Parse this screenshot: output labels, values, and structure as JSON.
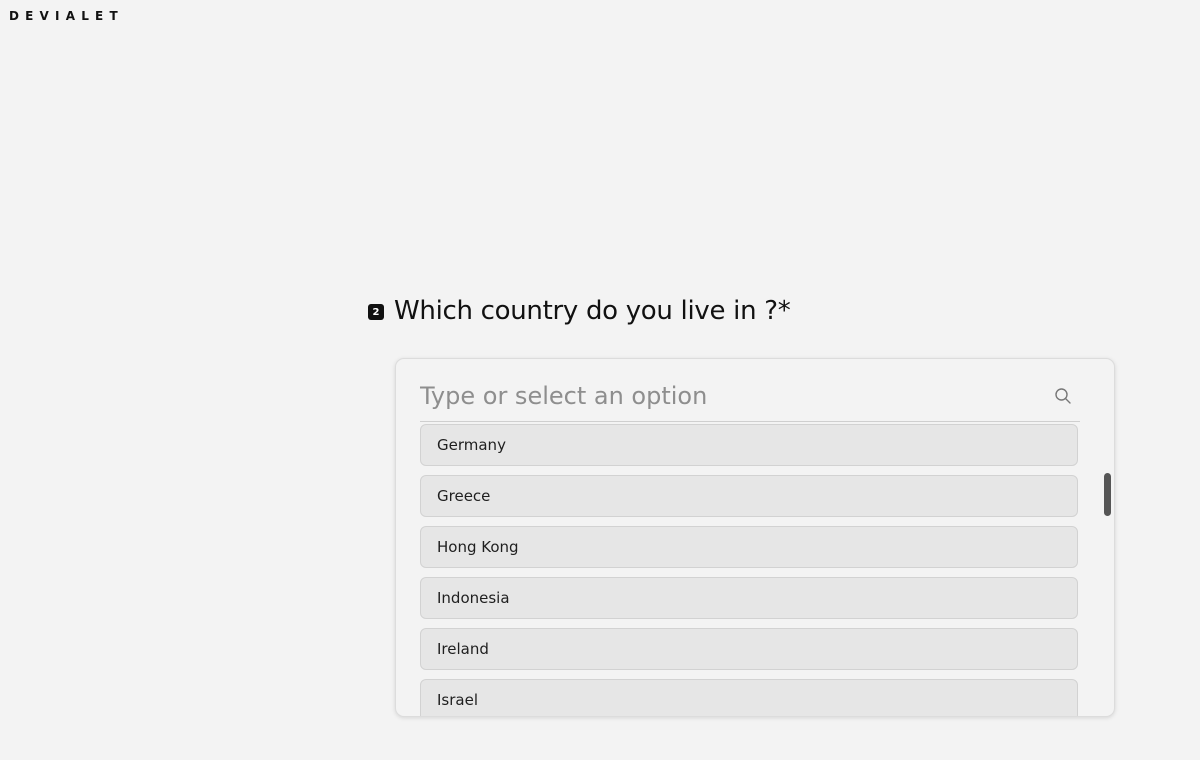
{
  "brand": {
    "logo": "DEVIALET"
  },
  "question": {
    "number": "2",
    "text": "Which country do you live in ?*"
  },
  "dropdown": {
    "placeholder": "Type or select an option",
    "search_icon": "search-icon",
    "options": [
      {
        "label": "Germany"
      },
      {
        "label": "Greece"
      },
      {
        "label": "Hong Kong"
      },
      {
        "label": "Indonesia"
      },
      {
        "label": "Ireland"
      },
      {
        "label": "Israel"
      }
    ]
  },
  "colors": {
    "background": "#f3f3f3",
    "option_bg": "#e6e6e6",
    "scrollbar": "#555555",
    "text": "#111111"
  }
}
